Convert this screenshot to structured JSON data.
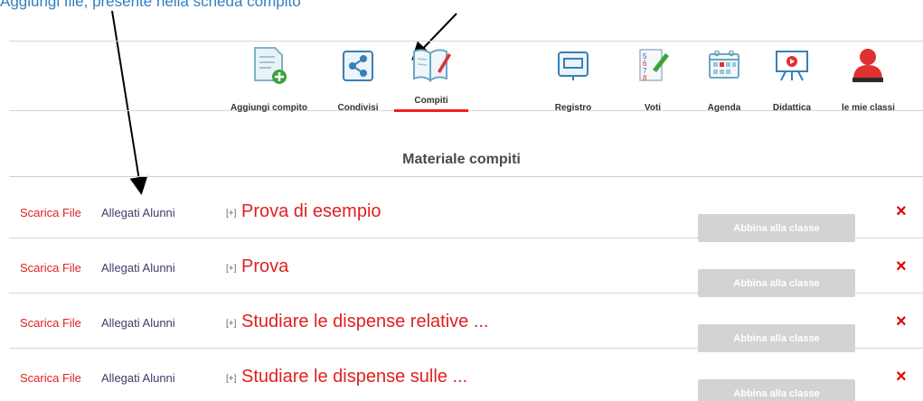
{
  "caption": "Aggiungi file, presente nella scheda compito",
  "toolbar": {
    "items": [
      {
        "label": "Aggiungi compito",
        "icon": "add-document-icon"
      },
      {
        "label": "Condivisi",
        "icon": "share-icon"
      },
      {
        "label": "Compiti",
        "icon": "open-book-icon"
      },
      {
        "label": "Registro",
        "icon": "register-icon"
      },
      {
        "label": "Voti",
        "icon": "grades-sheet-icon"
      },
      {
        "label": "Agenda",
        "icon": "calendar-icon"
      },
      {
        "label": "Didattica",
        "icon": "presentation-board-icon"
      },
      {
        "label": "le mie classi",
        "icon": "user-icon"
      }
    ],
    "active": "Compiti"
  },
  "section_title": "Materiale compiti",
  "rows": [
    {
      "download": "Scarica File",
      "attachments": "Allegati Alunni",
      "expander": "[+]",
      "title": "Prova di esempio",
      "button": "Abbina alla classe",
      "delete": "×"
    },
    {
      "download": "Scarica File",
      "attachments": "Allegati Alunni",
      "expander": "[+]",
      "title": "Prova",
      "button": "Abbina alla classe",
      "delete": "×"
    },
    {
      "download": "Scarica File",
      "attachments": "Allegati Alunni",
      "expander": "[+]",
      "title": "Studiare le dispense relative ...",
      "button": "Abbina alla classe",
      "delete": "×"
    },
    {
      "download": "Scarica File",
      "attachments": "Allegati Alunni",
      "expander": "[+]",
      "title": "Studiare le dispense sulle ...",
      "button": "Abbina alla classe",
      "delete": "×"
    }
  ],
  "colors": {
    "accent_red": "#e02020",
    "button_disabled": "#d3d3d3",
    "caption_blue": "#2f7fc1"
  }
}
